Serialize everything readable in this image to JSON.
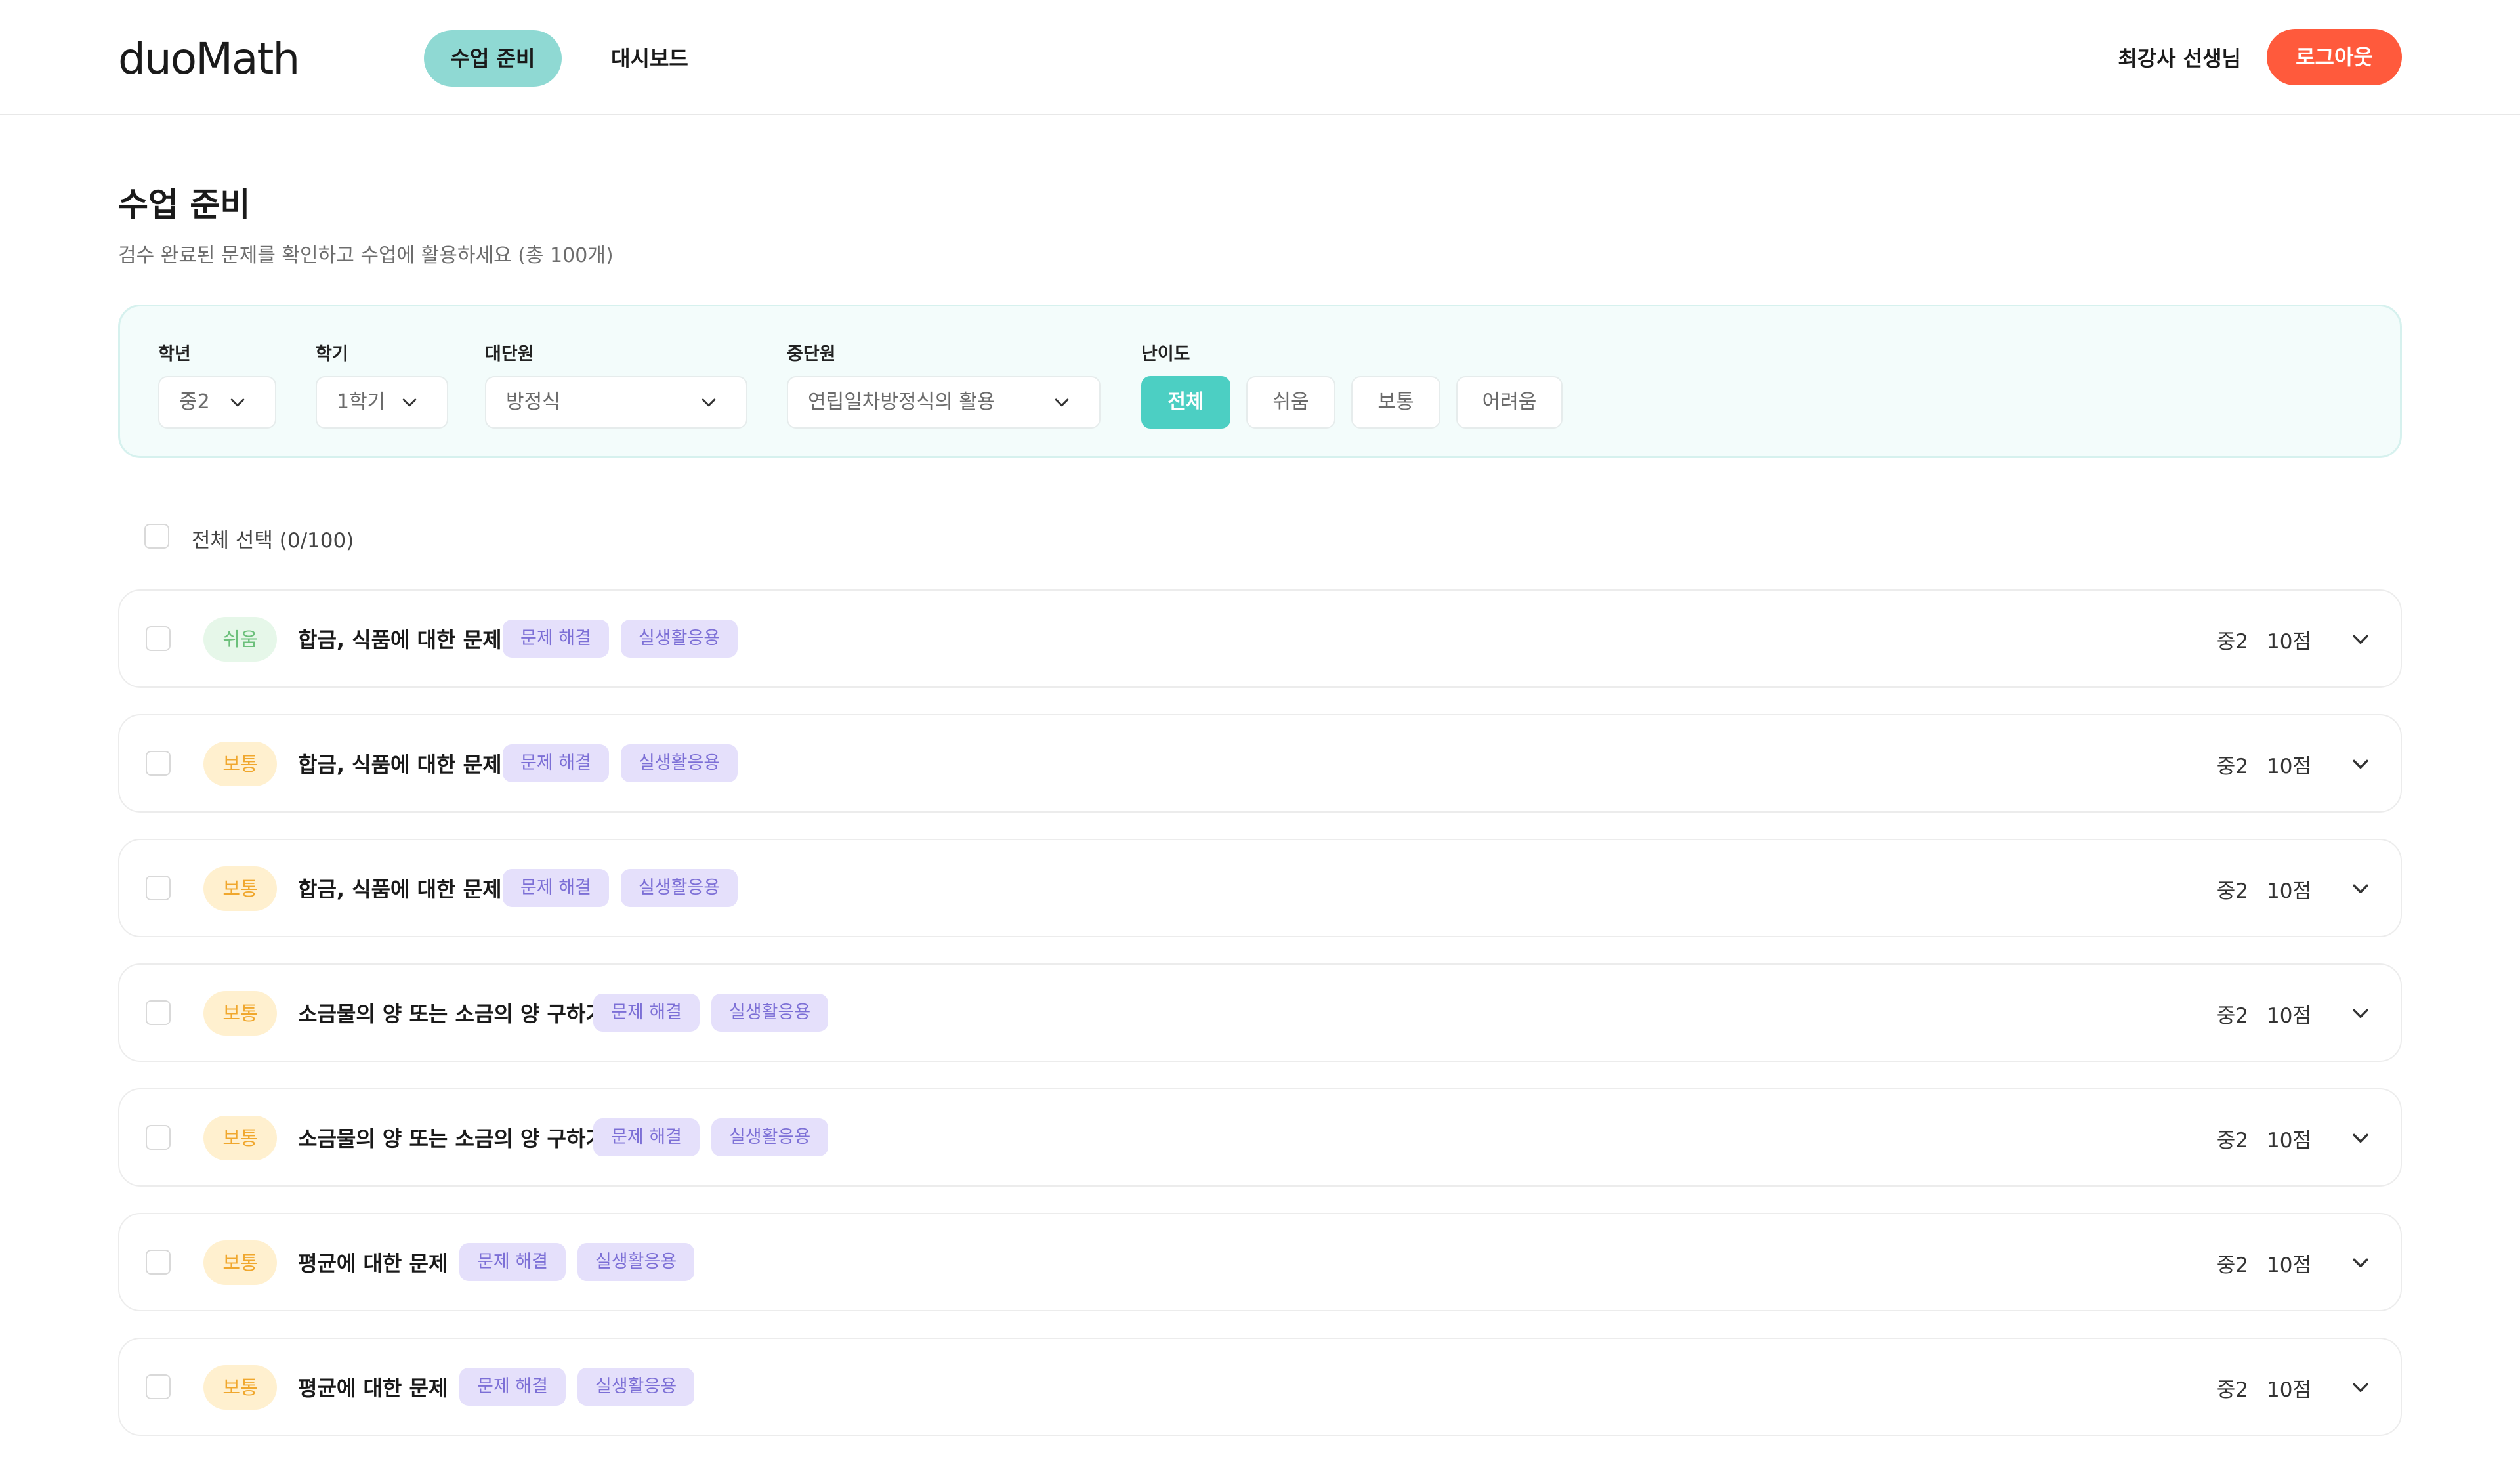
{
  "header": {
    "logo": "duoMath",
    "nav": [
      {
        "label": "수업 준비",
        "active": true
      },
      {
        "label": "대시보드",
        "active": false
      }
    ],
    "user_name": "최강사 선생님",
    "logout_label": "로그아웃"
  },
  "page": {
    "title": "수업 준비",
    "subtitle": "검수 완료된 문제를 확인하고 수업에 활용하세요 (총 100개)"
  },
  "filters": {
    "grade": {
      "label": "학년",
      "value": "중2"
    },
    "semester": {
      "label": "학기",
      "value": "1학기"
    },
    "major_unit": {
      "label": "대단원",
      "value": "방정식"
    },
    "mid_unit": {
      "label": "중단원",
      "value": "연립일차방정식의 활용"
    },
    "difficulty": {
      "label": "난이도",
      "options": [
        "전체",
        "쉬움",
        "보통",
        "어려움"
      ],
      "selected": "전체"
    }
  },
  "select_all": {
    "label": "전체 선택 (0/100)"
  },
  "problems": [
    {
      "level": "쉬움",
      "level_type": "easy",
      "title": "합금, 식품에 대한 문제",
      "tags": [
        "문제 해결",
        "실생활응용"
      ],
      "grade": "중2",
      "points": "10점"
    },
    {
      "level": "보통",
      "level_type": "normal",
      "title": "합금, 식품에 대한 문제",
      "tags": [
        "문제 해결",
        "실생활응용"
      ],
      "grade": "중2",
      "points": "10점"
    },
    {
      "level": "보통",
      "level_type": "normal",
      "title": "합금, 식품에 대한 문제",
      "tags": [
        "문제 해결",
        "실생활응용"
      ],
      "grade": "중2",
      "points": "10점"
    },
    {
      "level": "보통",
      "level_type": "normal",
      "title": "소금물의 양 또는 소금의 양 구하기",
      "tags": [
        "문제 해결",
        "실생활응용"
      ],
      "grade": "중2",
      "points": "10점"
    },
    {
      "level": "보통",
      "level_type": "normal",
      "title": "소금물의 양 또는 소금의 양 구하기",
      "tags": [
        "문제 해결",
        "실생활응용"
      ],
      "grade": "중2",
      "points": "10점"
    },
    {
      "level": "보통",
      "level_type": "normal",
      "title": "평균에 대한 문제",
      "tags": [
        "문제 해결",
        "실생활응용"
      ],
      "grade": "중2",
      "points": "10점"
    },
    {
      "level": "보통",
      "level_type": "normal",
      "title": "평균에 대한 문제",
      "tags": [
        "문제 해결",
        "실생활응용"
      ],
      "grade": "중2",
      "points": "10점"
    }
  ],
  "colors": {
    "accent_teal": "#4ccfc3",
    "nav_active": "#8fd9d3",
    "logout": "#ff5a3c",
    "tag_bg": "#e5e0fb",
    "tag_text": "#7c6fd6"
  }
}
